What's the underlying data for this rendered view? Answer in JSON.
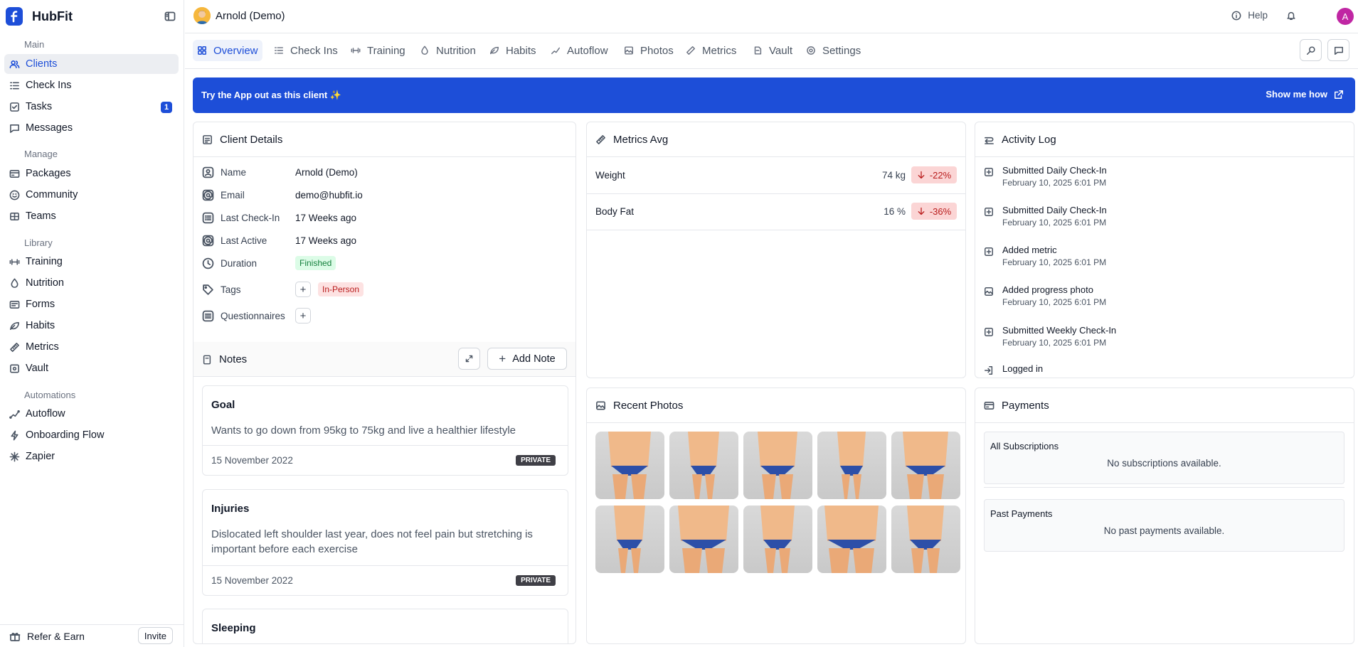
{
  "app": {
    "name": "HubFit"
  },
  "sidebar": {
    "sections": [
      "Main",
      "Manage",
      "Library",
      "Automations"
    ],
    "items": [
      {
        "label": "Clients",
        "icon": "users-icon"
      },
      {
        "label": "Check Ins",
        "icon": "list-icon"
      },
      {
        "label": "Tasks",
        "icon": "checkbox-icon",
        "badge": "1"
      },
      {
        "label": "Messages",
        "icon": "message-icon"
      },
      {
        "label": "Packages",
        "icon": "package-icon"
      },
      {
        "label": "Community",
        "icon": "smile-icon"
      },
      {
        "label": "Teams",
        "icon": "team-icon"
      },
      {
        "label": "Training",
        "icon": "dumbbell-icon"
      },
      {
        "label": "Nutrition",
        "icon": "drop-icon"
      },
      {
        "label": "Forms",
        "icon": "form-icon"
      },
      {
        "label": "Habits",
        "icon": "leaf-icon"
      },
      {
        "label": "Metrics",
        "icon": "ruler-icon"
      },
      {
        "label": "Vault",
        "icon": "vault-icon"
      },
      {
        "label": "Autoflow",
        "icon": "flow-icon"
      },
      {
        "label": "Onboarding Flow",
        "icon": "bolt-icon"
      },
      {
        "label": "Zapier",
        "icon": "asterisk-icon"
      }
    ],
    "refer_label": "Refer & Earn",
    "invite_label": "Invite"
  },
  "topbar": {
    "client_name": "Arnold (Demo)",
    "help_label": "Help",
    "user_initial": "A"
  },
  "tabs": [
    "Overview",
    "Check Ins",
    "Training",
    "Nutrition",
    "Habits",
    "Autoflow",
    "Photos",
    "Metrics",
    "Vault",
    "Settings"
  ],
  "banner": {
    "text": "Try the App out as this client ✨",
    "button": "Show me how"
  },
  "client_details": {
    "title": "Client Details",
    "rows": [
      {
        "label": "Name",
        "value": "Arnold (Demo)"
      },
      {
        "label": "Email",
        "value": "demo@hubfit.io"
      },
      {
        "label": "Last Check-In",
        "value": "17 Weeks ago"
      },
      {
        "label": "Last Active",
        "value": "17 Weeks ago"
      },
      {
        "label": "Duration",
        "value": "Finished"
      },
      {
        "label": "Tags",
        "value": "In-Person"
      },
      {
        "label": "Questionnaires",
        "value": ""
      }
    ]
  },
  "notes": {
    "title": "Notes",
    "add_label": "Add Note",
    "items": [
      {
        "title": "Goal",
        "body": "Wants to go down from 95kg to 75kg and live a healthier lifestyle",
        "date": "15 November 2022",
        "badge": "PRIVATE"
      },
      {
        "title": "Injuries",
        "body": "Dislocated left shoulder last year, does not feel pain but stretching is important before each exercise",
        "date": "15 November 2022",
        "badge": "PRIVATE"
      },
      {
        "title": "Sleeping",
        "body": "",
        "date": "",
        "badge": ""
      }
    ]
  },
  "metrics": {
    "title": "Metrics Avg",
    "items": [
      {
        "name": "Weight",
        "value": "74 kg",
        "change": "-22%"
      },
      {
        "name": "Body Fat",
        "value": "16 %",
        "change": "-36%"
      }
    ]
  },
  "activity": {
    "title": "Activity Log",
    "items": [
      {
        "title": "Submitted Daily Check-In",
        "date": "February 10, 2025 6:01 PM"
      },
      {
        "title": "Submitted Daily Check-In",
        "date": "February 10, 2025 6:01 PM"
      },
      {
        "title": "Added metric",
        "date": "February 10, 2025 6:01 PM"
      },
      {
        "title": "Added progress photo",
        "date": "February 10, 2025 6:01 PM"
      },
      {
        "title": "Submitted Weekly Check-In",
        "date": "February 10, 2025 6:01 PM"
      },
      {
        "title": "Logged in",
        "date": ""
      }
    ]
  },
  "photos": {
    "title": "Recent Photos"
  },
  "payments": {
    "title": "Payments",
    "subscriptions_title": "All Subscriptions",
    "subscriptions_empty": "No subscriptions available.",
    "past_title": "Past Payments",
    "past_empty": "No past payments available."
  }
}
